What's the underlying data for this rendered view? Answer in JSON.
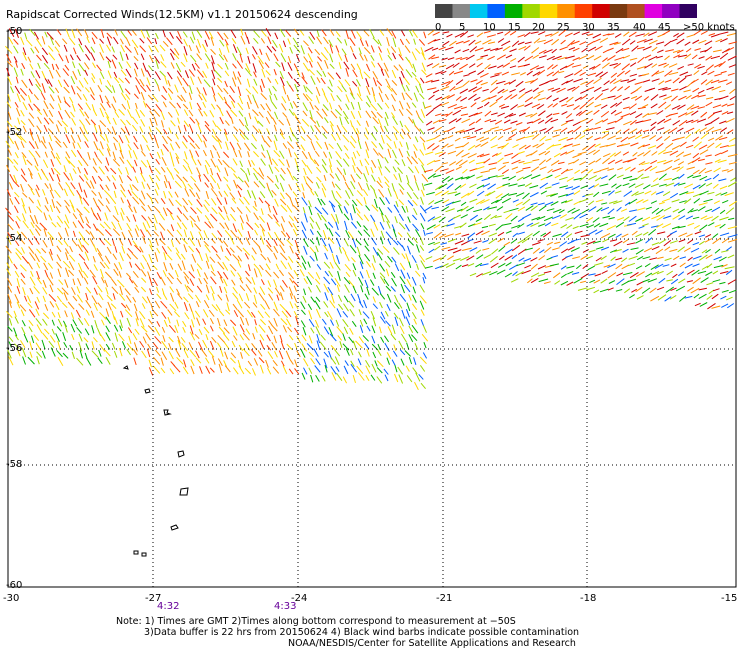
{
  "title": "Rapidscat Corrected Winds(12.5KM) v1.1 20150624 descending",
  "legend": {
    "labels": [
      "0",
      "5",
      "10",
      "15",
      "20",
      "25",
      "30",
      "35",
      "40",
      "45",
      ">50 knots"
    ],
    "colors": [
      "#444444",
      "#888888",
      "#00c8f0",
      "#0060ff",
      "#00b000",
      "#a0d800",
      "#ffd800",
      "#ff9000",
      "#ff4000",
      "#d00000",
      "#7a3a10",
      "#b05020",
      "#e000e0",
      "#9000c0",
      "#300060"
    ]
  },
  "axes": {
    "lat_labels": [
      "-50",
      "-52",
      "-54",
      "-56",
      "-58",
      "-60"
    ],
    "lon_labels": [
      "-30",
      "-27",
      "-24",
      "-21",
      "-18",
      "-15"
    ]
  },
  "times": [
    "4:32",
    "4:33"
  ],
  "notes": [
    "Note: 1) Times are GMT 2)Times along bottom correspond to measurement at −50S",
    "3)Data buffer is 22 hrs from 20150624 4) Black wind barbs indicate possible contamination",
    "NOAA/NESDIS/Center for Satellite Applications and Research"
  ]
}
